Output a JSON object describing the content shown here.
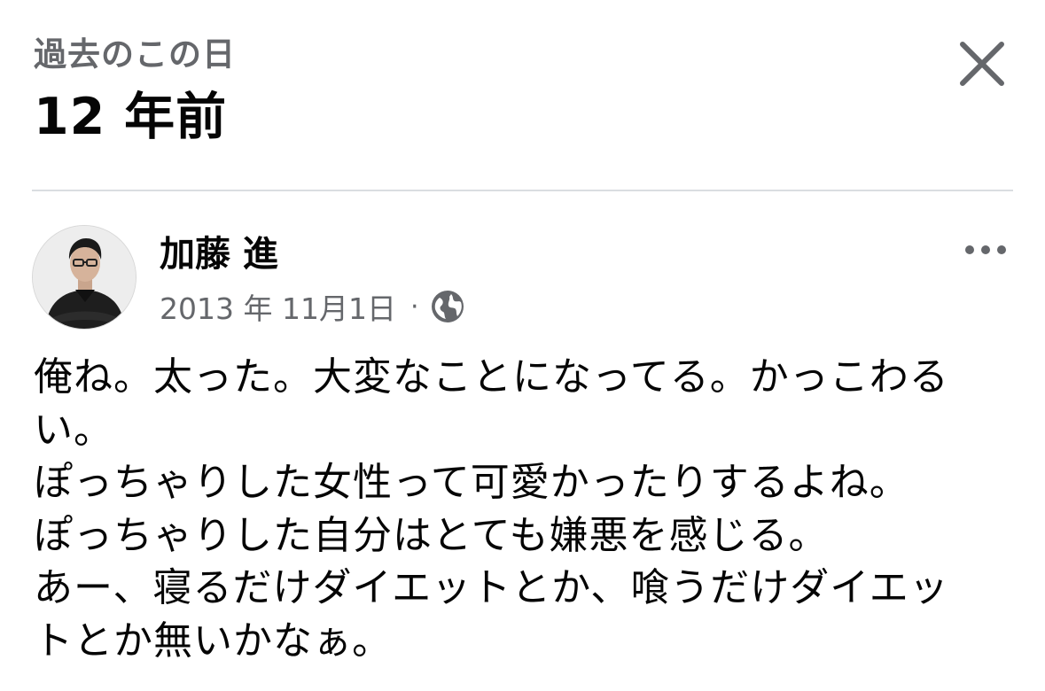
{
  "header": {
    "subtitle": "過去のこの日",
    "title": "12 年前",
    "close_icon": "close-icon"
  },
  "post": {
    "author": "加藤 進",
    "date": "2013 年 11月1日",
    "separator": "·",
    "privacy_icon": "globe-icon",
    "more_icon": "more-horizontal-icon",
    "avatar_icon": "profile-photo",
    "lines": [
      "俺ね。太った。大変なことになってる。かっこわる",
      "い。",
      "ぽっちゃりした女性って可愛かったりするよね。",
      "ぽっちゃりした自分はとても嫌悪を感じる。",
      "あー、寝るだけダイエットとか、喰うだけダイエッ",
      "トとか無いかなぁ。"
    ]
  },
  "colors": {
    "text_primary": "#050505",
    "text_secondary": "#65676b",
    "divider": "#dadde1"
  }
}
